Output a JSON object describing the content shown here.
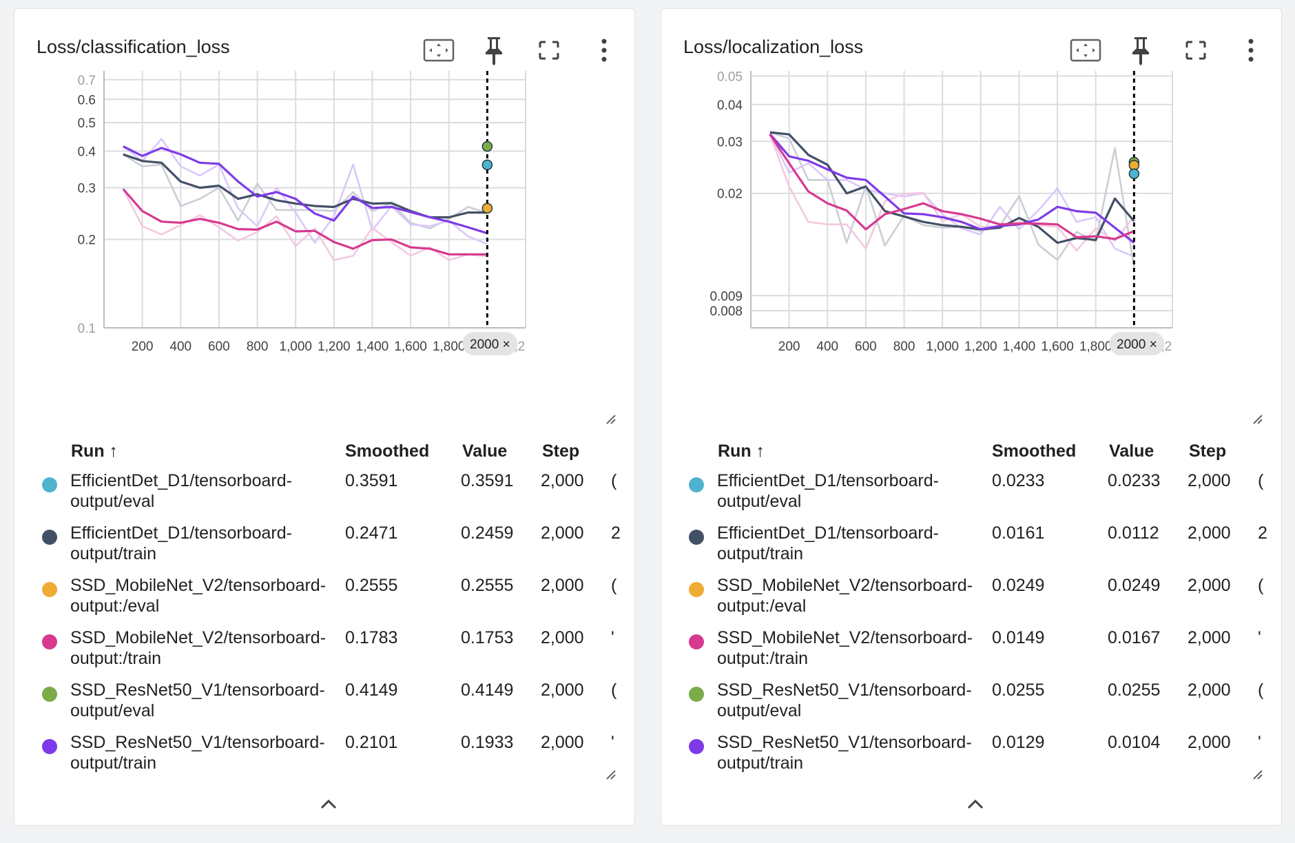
{
  "colors": {
    "EfficientDet_D1_eval": "#4fb3cf",
    "EfficientDet_D1_train": "#425066",
    "SSD_MobileNet_V2_eval": "#f0ab35",
    "SSD_MobileNet_V2_train": "#d7398f",
    "SSD_ResNet50_V1_eval": "#7cab4a",
    "SSD_ResNet50_V1_train": "#7e3ae8"
  },
  "icons": [
    "fit-domain-icon",
    "pin-icon",
    "fullscreen-icon",
    "more-vert-icon",
    "resize-handle-icon",
    "chevron-up-icon",
    "close-icon"
  ],
  "table_headers": {
    "run": "Run ↑",
    "smoothed": "Smoothed",
    "value": "Value",
    "step": "Step"
  },
  "panels": [
    {
      "title": "Loss/classification_loss",
      "step_badge": "2000 ×",
      "rows": [
        {
          "run": "EfficientDet_D1/tensorboard-output/eval",
          "smoothed": "0.3591",
          "value": "0.3591",
          "step": "2,000",
          "color": "#4fb3cf",
          "trunc": "("
        },
        {
          "run": "EfficientDet_D1/tensorboard-output/train",
          "smoothed": "0.2471",
          "value": "0.2459",
          "step": "2,000",
          "color": "#425066",
          "trunc": "2"
        },
        {
          "run": "SSD_MobileNet_V2/tensorboard-output:/eval",
          "smoothed": "0.2555",
          "value": "0.2555",
          "step": "2,000",
          "color": "#f0ab35",
          "trunc": "("
        },
        {
          "run": "SSD_MobileNet_V2/tensorboard-output:/train",
          "smoothed": "0.1783",
          "value": "0.1753",
          "step": "2,000",
          "color": "#d7398f",
          "trunc": "'"
        },
        {
          "run": "SSD_ResNet50_V1/tensorboard-output/eval",
          "smoothed": "0.4149",
          "value": "0.4149",
          "step": "2,000",
          "color": "#7cab4a",
          "trunc": "("
        },
        {
          "run": "SSD_ResNet50_V1/tensorboard-output/train",
          "smoothed": "0.2101",
          "value": "0.1933",
          "step": "2,000",
          "color": "#7e3ae8",
          "trunc": "'"
        }
      ]
    },
    {
      "title": "Loss/localization_loss",
      "step_badge": "2000 ×",
      "rows": [
        {
          "run": "EfficientDet_D1/tensorboard-output/eval",
          "smoothed": "0.0233",
          "value": "0.0233",
          "step": "2,000",
          "color": "#4fb3cf",
          "trunc": "("
        },
        {
          "run": "EfficientDet_D1/tensorboard-output/train",
          "smoothed": "0.0161",
          "value": "0.0112",
          "step": "2,000",
          "color": "#425066",
          "trunc": "2"
        },
        {
          "run": "SSD_MobileNet_V2/tensorboard-output:/eval",
          "smoothed": "0.0249",
          "value": "0.0249",
          "step": "2,000",
          "color": "#f0ab35",
          "trunc": "("
        },
        {
          "run": "SSD_MobileNet_V2/tensorboard-output:/train",
          "smoothed": "0.0149",
          "value": "0.0167",
          "step": "2,000",
          "color": "#d7398f",
          "trunc": "'"
        },
        {
          "run": "SSD_ResNet50_V1/tensorboard-output/eval",
          "smoothed": "0.0255",
          "value": "0.0255",
          "step": "2,000",
          "color": "#7cab4a",
          "trunc": "("
        },
        {
          "run": "SSD_ResNet50_V1/tensorboard-output/train",
          "smoothed": "0.0129",
          "value": "0.0104",
          "step": "2,000",
          "color": "#7e3ae8",
          "trunc": "'"
        }
      ]
    }
  ],
  "chart_data": [
    {
      "type": "line",
      "title": "Loss/classification_loss",
      "yscale": "log",
      "ylim": [
        0.1,
        0.75
      ],
      "xlim": [
        0,
        2200
      ],
      "grid": true,
      "x_tick_labels": [
        "200",
        "400",
        "600",
        "800",
        "1,000",
        "1,200",
        "1,400",
        "1,600",
        "1,800",
        "2,2"
      ],
      "y_tick_labels": [
        "0.7",
        "0.6",
        "0.5",
        "0.4",
        "0.3",
        "0.2",
        "0.1"
      ],
      "y_ticks": [
        0.7,
        0.6,
        0.5,
        0.4,
        0.3,
        0.2,
        0.1
      ],
      "y_dim": [
        0.7,
        0.1
      ],
      "x_ticks": [
        200,
        400,
        600,
        800,
        1000,
        1200,
        1400,
        1600,
        1800,
        2200
      ],
      "cursor_step": 2000,
      "x": [
        100,
        200,
        300,
        400,
        500,
        600,
        700,
        800,
        900,
        1000,
        1100,
        1200,
        1300,
        1400,
        1500,
        1600,
        1700,
        1800,
        1900,
        2000
      ],
      "series": [
        {
          "name": "EfficientDet_D1/tensorboard-output/train",
          "color": "#425066",
          "smoothed": true,
          "values": [
            0.39,
            0.37,
            0.365,
            0.315,
            0.3,
            0.305,
            0.275,
            0.285,
            0.272,
            0.265,
            0.26,
            0.258,
            0.275,
            0.265,
            0.266,
            0.25,
            0.238,
            0.238,
            0.247,
            0.247
          ]
        },
        {
          "name": "EfficientDet_D1/tensorboard-output/train",
          "color": "#425066",
          "smoothed": false,
          "values": [
            0.39,
            0.355,
            0.36,
            0.26,
            0.275,
            0.3,
            0.232,
            0.31,
            0.252,
            0.252,
            0.252,
            0.25,
            0.29,
            0.25,
            0.266,
            0.228,
            0.218,
            0.235,
            0.258,
            0.246
          ]
        },
        {
          "name": "SSD_ResNet50_V1/tensorboard-output/train",
          "color": "#7e3ae8",
          "smoothed": true,
          "values": [
            0.415,
            0.385,
            0.41,
            0.39,
            0.365,
            0.362,
            0.315,
            0.28,
            0.29,
            0.275,
            0.245,
            0.232,
            0.28,
            0.256,
            0.258,
            0.248,
            0.238,
            0.23,
            0.22,
            0.21
          ]
        },
        {
          "name": "SSD_ResNet50_V1/tensorboard-output/train",
          "color": "#7e3ae8",
          "smoothed": false,
          "values": [
            0.415,
            0.37,
            0.44,
            0.355,
            0.33,
            0.36,
            0.255,
            0.222,
            0.3,
            0.247,
            0.195,
            0.24,
            0.36,
            0.215,
            0.26,
            0.225,
            0.222,
            0.232,
            0.205,
            0.193
          ]
        },
        {
          "name": "SSD_MobileNet_V2/tensorboard-output:/train",
          "color": "#d7398f",
          "smoothed": true,
          "values": [
            0.297,
            0.25,
            0.23,
            0.228,
            0.235,
            0.228,
            0.217,
            0.216,
            0.23,
            0.213,
            0.214,
            0.196,
            0.186,
            0.199,
            0.2,
            0.188,
            0.186,
            0.178,
            0.178,
            0.178
          ]
        },
        {
          "name": "SSD_MobileNet_V2/tensorboard-output:/train",
          "color": "#d7398f",
          "smoothed": false,
          "values": [
            0.297,
            0.222,
            0.208,
            0.224,
            0.242,
            0.22,
            0.198,
            0.212,
            0.24,
            0.19,
            0.218,
            0.17,
            0.176,
            0.219,
            0.196,
            0.176,
            0.188,
            0.17,
            0.178,
            0.175
          ]
        }
      ],
      "points": [
        {
          "name": "SSD_ResNet50_V1/tensorboard-output/eval",
          "x": 2000,
          "y": 0.4149,
          "color": "#7cab4a"
        },
        {
          "name": "EfficientDet_D1/tensorboard-output/eval",
          "x": 2000,
          "y": 0.3591,
          "color": "#4fb3cf"
        },
        {
          "name": "SSD_MobileNet_V2/tensorboard-output:/eval",
          "x": 2000,
          "y": 0.2555,
          "color": "#f0ab35"
        }
      ]
    },
    {
      "type": "line",
      "title": "Loss/localization_loss",
      "yscale": "log",
      "ylim": [
        0.007,
        0.052
      ],
      "xlim": [
        0,
        2200
      ],
      "grid": true,
      "x_tick_labels": [
        "200",
        "400",
        "600",
        "800",
        "1,000",
        "1,200",
        "1,400",
        "1,600",
        "1,800",
        "2,2"
      ],
      "y_tick_labels": [
        "0.05",
        "0.04",
        "0.03",
        "0.02",
        "0.009",
        "0.008"
      ],
      "y_ticks": [
        0.05,
        0.04,
        0.03,
        0.02,
        0.009,
        0.008
      ],
      "y_dim": [
        0.05
      ],
      "x_ticks": [
        200,
        400,
        600,
        800,
        1000,
        1200,
        1400,
        1600,
        1800,
        2200
      ],
      "cursor_step": 2000,
      "x": [
        100,
        200,
        300,
        400,
        500,
        600,
        700,
        800,
        900,
        1000,
        1100,
        1200,
        1300,
        1400,
        1500,
        1600,
        1700,
        1800,
        1900,
        2000
      ],
      "series": [
        {
          "name": "EfficientDet_D1/tensorboard-output/train",
          "color": "#425066",
          "smoothed": true,
          "values": [
            0.0322,
            0.0317,
            0.027,
            0.025,
            0.02,
            0.0211,
            0.0174,
            0.0167,
            0.016,
            0.0156,
            0.0154,
            0.0151,
            0.0153,
            0.0165,
            0.0154,
            0.0136,
            0.0141,
            0.0139,
            0.0192,
            0.0161
          ]
        },
        {
          "name": "EfficientDet_D1/tensorboard-output/train",
          "color": "#425066",
          "smoothed": false,
          "values": [
            0.0322,
            0.0307,
            0.0222,
            0.0222,
            0.0136,
            0.0212,
            0.0133,
            0.0168,
            0.0156,
            0.0153,
            0.0154,
            0.0149,
            0.0155,
            0.0196,
            0.0134,
            0.0119,
            0.0148,
            0.0137,
            0.0285,
            0.0112
          ]
        },
        {
          "name": "SSD_ResNet50_V1/tensorboard-output/train",
          "color": "#7e3ae8",
          "smoothed": true,
          "values": [
            0.0318,
            0.0267,
            0.0258,
            0.0241,
            0.0226,
            0.0222,
            0.0195,
            0.0171,
            0.017,
            0.0166,
            0.016,
            0.0151,
            0.0155,
            0.0157,
            0.0163,
            0.018,
            0.0174,
            0.0172,
            0.0153,
            0.0136
          ]
        },
        {
          "name": "SSD_ResNet50_V1/tensorboard-output/train",
          "color": "#7e3ae8",
          "smoothed": false,
          "values": [
            0.0318,
            0.0235,
            0.0253,
            0.0222,
            0.0222,
            0.0206,
            0.02,
            0.0195,
            0.02,
            0.017,
            0.0152,
            0.0145,
            0.018,
            0.0151,
            0.0175,
            0.0208,
            0.016,
            0.0166,
            0.013,
            0.0122
          ]
        },
        {
          "name": "SSD_MobileNet_V2/tensorboard-output:/train",
          "color": "#d7398f",
          "smoothed": true,
          "values": [
            0.0317,
            0.0253,
            0.0203,
            0.0185,
            0.0175,
            0.0151,
            0.017,
            0.0177,
            0.0185,
            0.0174,
            0.017,
            0.0164,
            0.0157,
            0.0158,
            0.0158,
            0.0157,
            0.0142,
            0.0143,
            0.014,
            0.0149
          ]
        },
        {
          "name": "SSD_MobileNet_V2/tensorboard-output:/train",
          "color": "#d7398f",
          "smoothed": false,
          "values": [
            0.0317,
            0.0211,
            0.016,
            0.0157,
            0.0157,
            0.013,
            0.0188,
            0.0199,
            0.0201,
            0.0161,
            0.017,
            0.0154,
            0.0154,
            0.016,
            0.0156,
            0.0154,
            0.0128,
            0.0152,
            0.0138,
            0.0167
          ]
        }
      ],
      "points": [
        {
          "name": "SSD_ResNet50_V1/tensorboard-output/eval",
          "x": 2000,
          "y": 0.0255,
          "color": "#7cab4a"
        },
        {
          "name": "SSD_MobileNet_V2/tensorboard-output:/eval",
          "x": 2000,
          "y": 0.0249,
          "color": "#f0ab35"
        },
        {
          "name": "EfficientDet_D1/tensorboard-output/eval",
          "x": 2000,
          "y": 0.0233,
          "color": "#4fb3cf"
        }
      ]
    }
  ]
}
